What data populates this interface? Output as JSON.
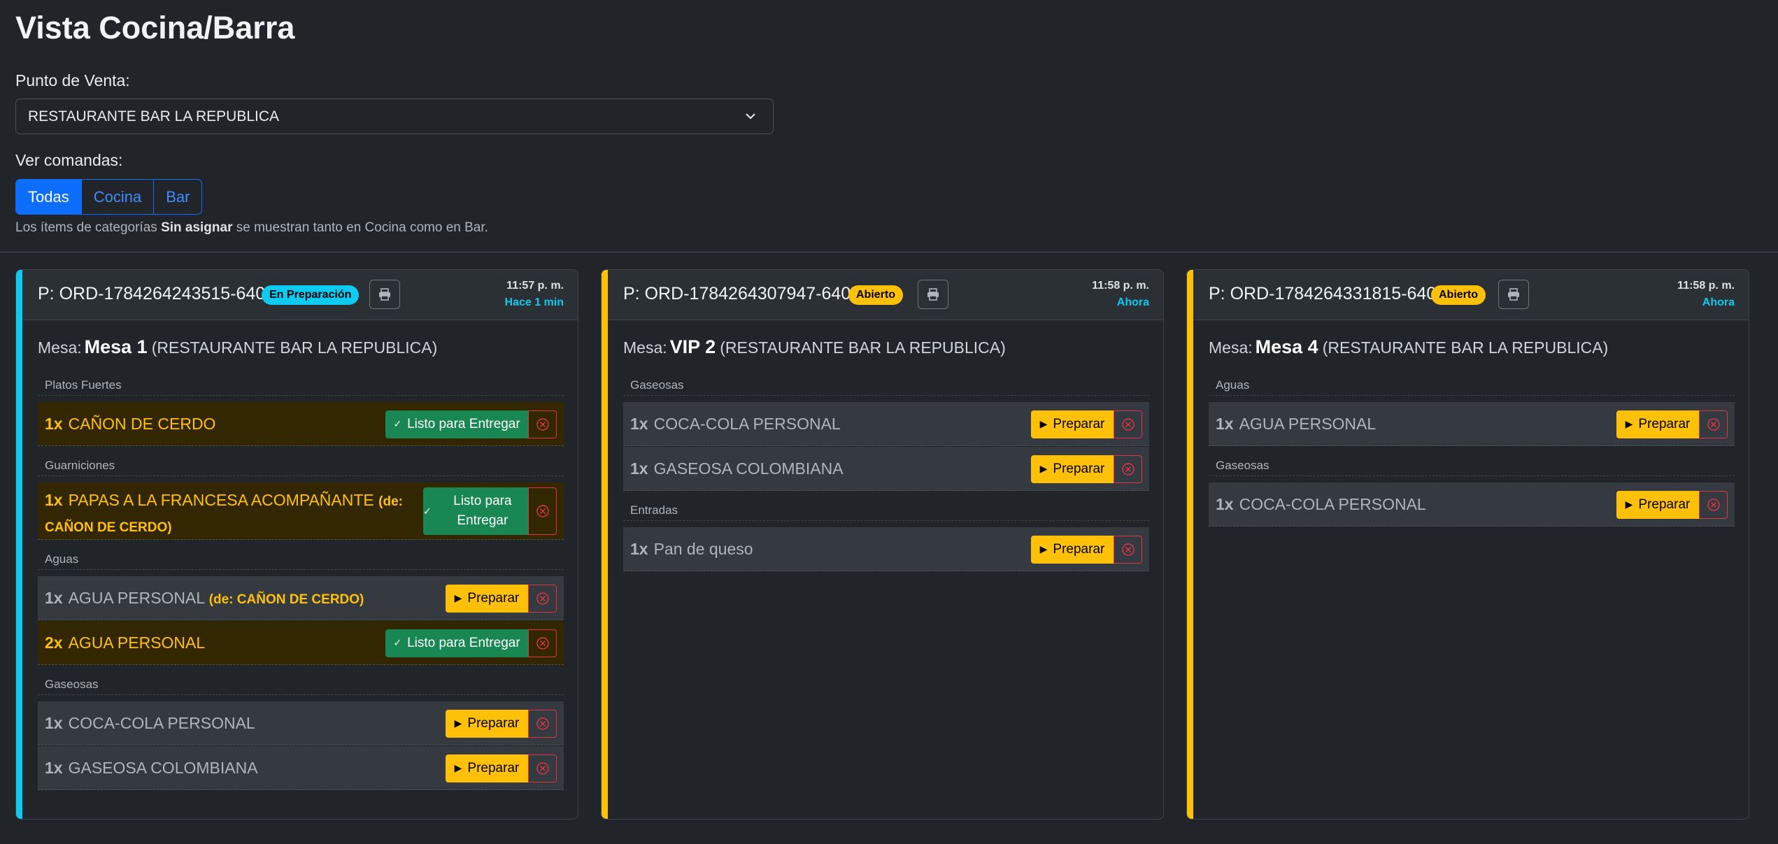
{
  "page": {
    "title": "Vista Cocina/Barra",
    "pos_label": "Punto de Venta:",
    "pos_value": "RESTAURANTE BAR LA REPUBLICA",
    "view_label": "Ver comandas:",
    "filters": [
      "Todas",
      "Cocina",
      "Bar"
    ],
    "active_filter": "Todas",
    "hint_prefix": "Los ítems de categorías ",
    "hint_bold": "Sin asignar",
    "hint_suffix": " se muestran tanto en Cocina como en Bar."
  },
  "colors": {
    "in_progress": "#0dcaf0",
    "open": "#ffc107",
    "ready_button": "#198754",
    "prepare_button": "#ffc107",
    "cancel": "#dc3545"
  },
  "orders": [
    {
      "id": "P: ORD-1784264243515-6405",
      "status": "En Preparación",
      "status_color": "#0dcaf0",
      "time": "11:57 p. m.",
      "elapsed": "Hace 1 min",
      "mesa_label": "Mesa:",
      "mesa": "Mesa 1",
      "venue": "(RESTAURANTE BAR LA REPUBLICA)",
      "groups": [
        {
          "category": "Platos Fuertes",
          "items": [
            {
              "qty": "1x",
              "name": "CAÑON DE CERDO",
              "note": "",
              "state": "ready",
              "action": "Listo para Entregar"
            }
          ]
        },
        {
          "category": "Guarniciones",
          "items": [
            {
              "qty": "1x",
              "name": "PAPAS A LA FRANCESA ACOMPAÑANTE",
              "note": "(de: CAÑON DE CERDO)",
              "state": "ready",
              "action": "Listo para Entregar"
            }
          ]
        },
        {
          "category": "Aguas",
          "items": [
            {
              "qty": "1x",
              "name": "AGUA PERSONAL",
              "note": "(de: CAÑON DE CERDO)",
              "state": "pending",
              "action": "Preparar"
            },
            {
              "qty": "2x",
              "name": "AGUA PERSONAL",
              "note": "",
              "state": "ready",
              "action": "Listo para Entregar"
            }
          ]
        },
        {
          "category": "Gaseosas",
          "items": [
            {
              "qty": "1x",
              "name": "COCA-COLA PERSONAL",
              "note": "",
              "state": "pending",
              "action": "Preparar"
            },
            {
              "qty": "1x",
              "name": "GASEOSA COLOMBIANA",
              "note": "",
              "state": "pending",
              "action": "Preparar"
            }
          ]
        }
      ]
    },
    {
      "id": "P: ORD-1784264307947-6405",
      "status": "Abierto",
      "status_color": "#ffc107",
      "time": "11:58 p. m.",
      "elapsed": "Ahora",
      "mesa_label": "Mesa:",
      "mesa": "VIP 2",
      "venue": "(RESTAURANTE BAR LA REPUBLICA)",
      "groups": [
        {
          "category": "Gaseosas",
          "items": [
            {
              "qty": "1x",
              "name": "COCA-COLA PERSONAL",
              "note": "",
              "state": "pending",
              "action": "Preparar"
            },
            {
              "qty": "1x",
              "name": "GASEOSA COLOMBIANA",
              "note": "",
              "state": "pending",
              "action": "Preparar"
            }
          ]
        },
        {
          "category": "Entradas",
          "items": [
            {
              "qty": "1x",
              "name": "Pan de queso",
              "note": "",
              "state": "pending",
              "action": "Preparar"
            }
          ]
        }
      ]
    },
    {
      "id": "P: ORD-1784264331815-6405",
      "status": "Abierto",
      "status_color": "#ffc107",
      "time": "11:58 p. m.",
      "elapsed": "Ahora",
      "mesa_label": "Mesa:",
      "mesa": "Mesa 4",
      "venue": "(RESTAURANTE BAR LA REPUBLICA)",
      "groups": [
        {
          "category": "Aguas",
          "items": [
            {
              "qty": "1x",
              "name": "AGUA PERSONAL",
              "note": "",
              "state": "pending",
              "action": "Preparar"
            }
          ]
        },
        {
          "category": "Gaseosas",
          "items": [
            {
              "qty": "1x",
              "name": "COCA-COLA PERSONAL",
              "note": "",
              "state": "pending",
              "action": "Preparar"
            }
          ]
        }
      ]
    }
  ]
}
